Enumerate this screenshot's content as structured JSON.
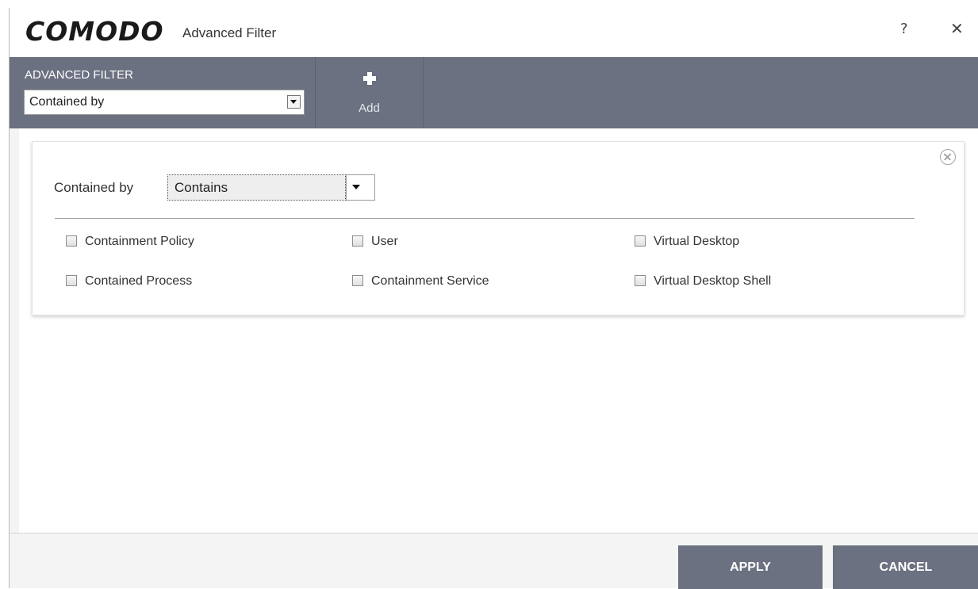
{
  "window": {
    "logo": "COMODO",
    "title": "Advanced Filter",
    "help_label": "?",
    "close_label": "✕"
  },
  "toolbar": {
    "filter_label": "ADVANCED FILTER",
    "filter_value": "Contained by",
    "add_label": "Add"
  },
  "filter": {
    "condition_label": "Contained by",
    "operator_value": "Contains",
    "options": [
      {
        "label": "Containment Policy",
        "checked": false
      },
      {
        "label": "User",
        "checked": false
      },
      {
        "label": "Virtual Desktop",
        "checked": false
      },
      {
        "label": "Contained Process",
        "checked": false
      },
      {
        "label": "Containment Service",
        "checked": false
      },
      {
        "label": "Virtual Desktop Shell",
        "checked": false
      }
    ]
  },
  "buttons": {
    "apply": "APPLY",
    "cancel": "CANCEL"
  },
  "colors": {
    "toolbar_bg": "#6b7180",
    "button_bg": "#6b7180"
  }
}
